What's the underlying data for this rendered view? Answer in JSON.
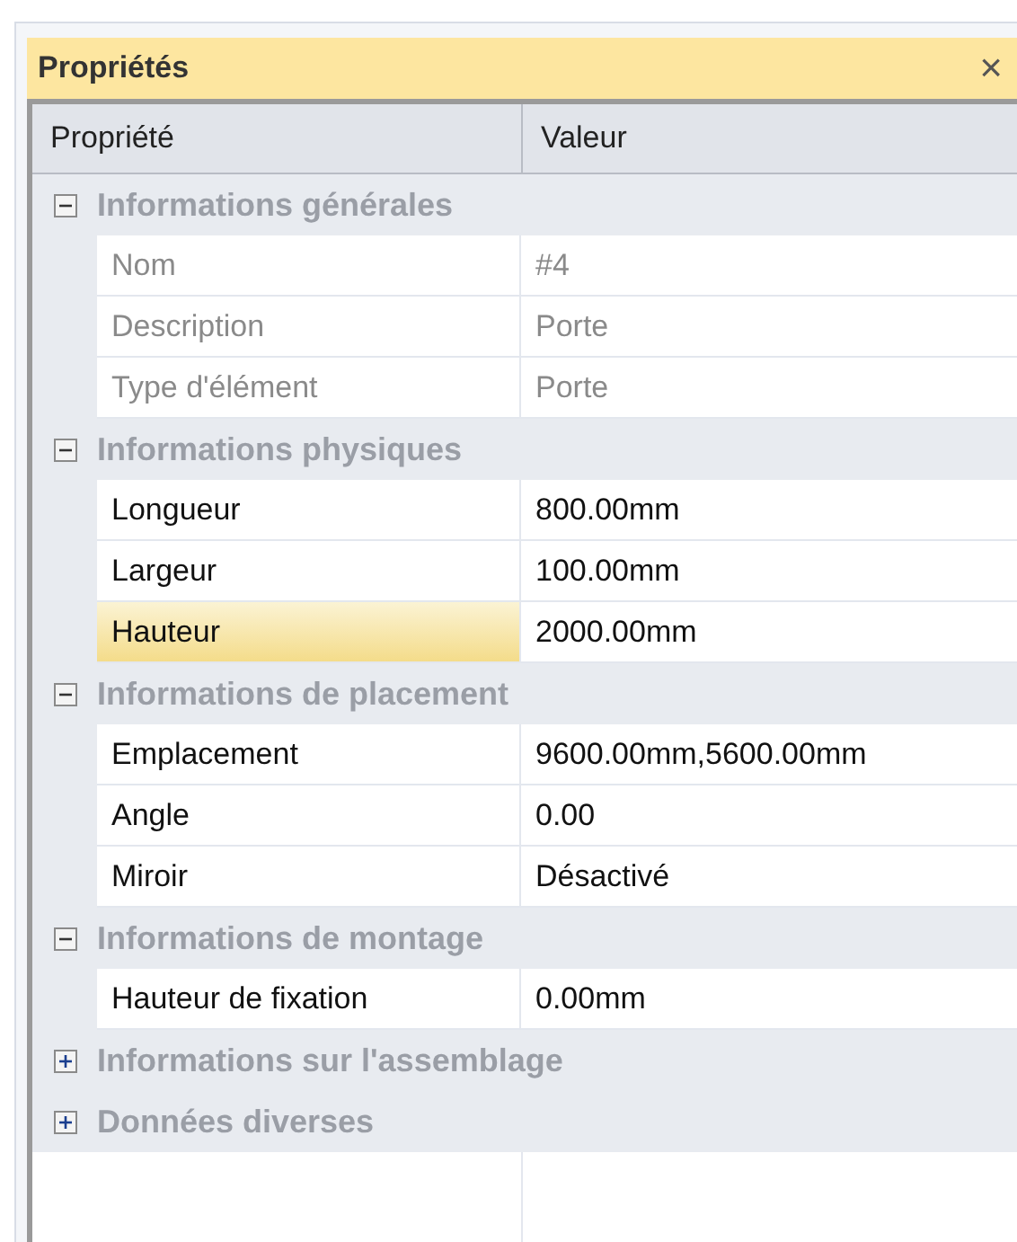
{
  "panel": {
    "title": "Propriétés",
    "close": "×"
  },
  "grid": {
    "columns": [
      "Propriété",
      "Valeur"
    ],
    "groups": [
      {
        "name": "Informations générales",
        "expanded": true,
        "rows": [
          {
            "name": "Nom",
            "value": "#4",
            "readonly": true,
            "selected": false
          },
          {
            "name": "Description",
            "value": "Porte",
            "readonly": true,
            "selected": false
          },
          {
            "name": "Type d'élément",
            "value": "Porte",
            "readonly": true,
            "selected": false
          }
        ]
      },
      {
        "name": "Informations physiques",
        "expanded": true,
        "rows": [
          {
            "name": "Longueur",
            "value": "800.00mm",
            "readonly": false,
            "selected": false
          },
          {
            "name": "Largeur",
            "value": "100.00mm",
            "readonly": false,
            "selected": false
          },
          {
            "name": "Hauteur",
            "value": "2000.00mm",
            "readonly": false,
            "selected": true
          }
        ]
      },
      {
        "name": "Informations de placement",
        "expanded": true,
        "rows": [
          {
            "name": "Emplacement",
            "value": "9600.00mm,5600.00mm",
            "readonly": false,
            "selected": false
          },
          {
            "name": "Angle",
            "value": "0.00",
            "readonly": false,
            "selected": false
          },
          {
            "name": "Miroir",
            "value": "Désactivé",
            "readonly": false,
            "selected": false
          }
        ]
      },
      {
        "name": "Informations de montage",
        "expanded": true,
        "rows": [
          {
            "name": "Hauteur de fixation",
            "value": "0.00mm",
            "readonly": false,
            "selected": false
          }
        ]
      },
      {
        "name": "Informations sur l'assemblage",
        "expanded": false
      },
      {
        "name": "Données diverses",
        "expanded": false
      }
    ]
  }
}
